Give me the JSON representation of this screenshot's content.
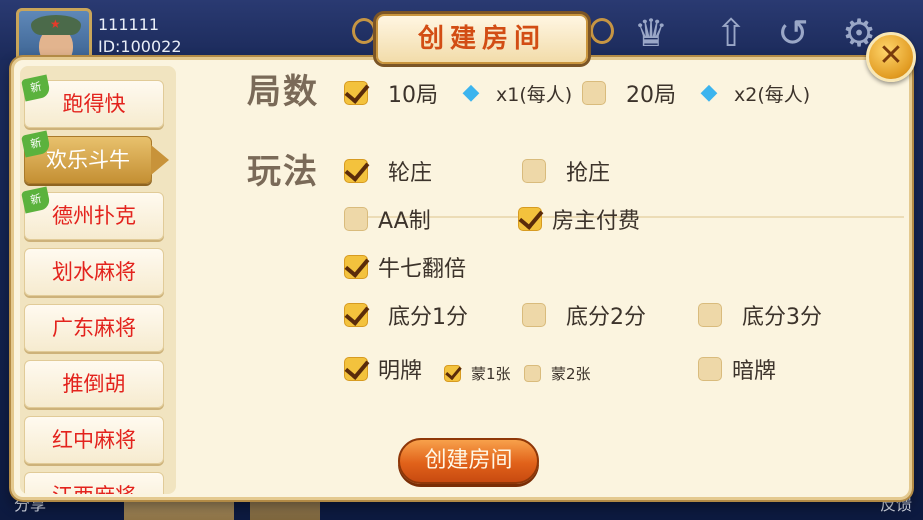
{
  "user": {
    "name": "111111",
    "id": "ID:100022"
  },
  "header": {
    "title": "创建房间"
  },
  "close": {
    "label": "✕"
  },
  "top_icons": [
    "trophy-icon",
    "arrow-up-icon",
    "refresh-icon",
    "gear-icon"
  ],
  "bottom": {
    "left_text": "分享",
    "right_text": "反馈"
  },
  "sidebar": {
    "new_badge": "新",
    "items": [
      {
        "label": "跑得快",
        "is_new": true,
        "active": false
      },
      {
        "label": "欢乐斗牛",
        "is_new": true,
        "active": true
      },
      {
        "label": "德州扑克",
        "is_new": true,
        "active": false
      },
      {
        "label": "划水麻将",
        "is_new": false,
        "active": false
      },
      {
        "label": "广东麻将",
        "is_new": false,
        "active": false
      },
      {
        "label": "推倒胡",
        "is_new": false,
        "active": false
      },
      {
        "label": "红中麻将",
        "is_new": false,
        "active": false
      },
      {
        "label": "江西麻将",
        "is_new": false,
        "active": false
      }
    ]
  },
  "rounds": {
    "label": "局数",
    "options": [
      {
        "label": "10局",
        "cost": "x1(每人)",
        "checked": true
      },
      {
        "label": "20局",
        "cost": "x2(每人)",
        "checked": false
      }
    ]
  },
  "gameplay": {
    "label": "玩法",
    "banker": [
      {
        "label": "轮庄",
        "checked": true
      },
      {
        "label": "抢庄",
        "checked": false
      }
    ],
    "payment": [
      {
        "label": "AA制",
        "checked": false
      },
      {
        "label": "房主付费",
        "checked": true
      }
    ],
    "double": {
      "label": "牛七翻倍",
      "checked": true
    },
    "base_score": [
      {
        "label": "底分1分",
        "checked": true
      },
      {
        "label": "底分2分",
        "checked": false
      },
      {
        "label": "底分3分",
        "checked": false
      }
    ],
    "show_cards": {
      "label": "明牌",
      "checked": true
    },
    "show_sub": [
      {
        "label": "蒙1张",
        "checked": true
      },
      {
        "label": "蒙2张",
        "checked": false
      }
    ],
    "hidden_cards": {
      "label": "暗牌",
      "checked": false
    }
  },
  "create_button": {
    "label": "创建房间"
  },
  "colors": {
    "accent": "#f3c23d",
    "tab_text": "#e3231d",
    "button": "#e1621a",
    "dialog_bg": "#fbf4df"
  }
}
